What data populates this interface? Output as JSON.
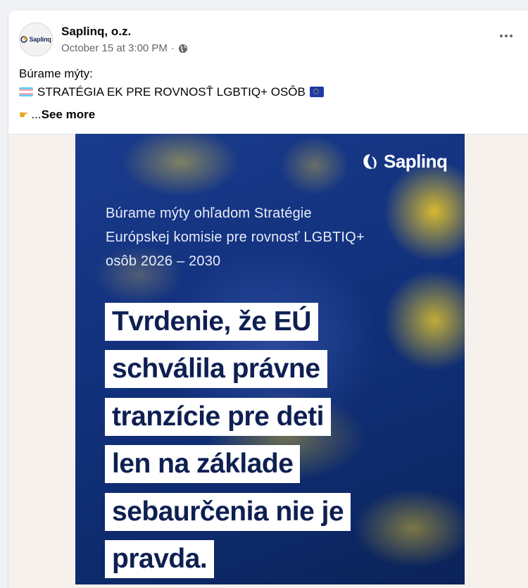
{
  "post": {
    "author": "Saplinq, o.z.",
    "avatar_label": "Saplinq",
    "timestamp": "October 15 at 3:00 PM",
    "separator": "·",
    "privacy_icon": "globe-icon",
    "more_icon": "more-horizontal-icon",
    "text_line1": "Búrame mýty:",
    "text_line2": "STRATÉGIA EK PRE ROVNOSŤ LGBTIQ+ OSÔB",
    "flag_left": "transgender-flag-emoji",
    "flag_right": "eu-flag-emoji",
    "pointing_icon": "pointing-hand-emoji",
    "ellipsis": "...",
    "see_more": "See more"
  },
  "poster": {
    "logo_text": "Saplinq",
    "subtitle_lines": [
      "Búrame mýty ohľadom Stratégie",
      "Európskej komisie pre rovnosť LGBTIQ+",
      "osôb 2026 – 2030"
    ],
    "headline_lines": [
      "Tvrdenie, že EÚ",
      "schválila právne",
      "tranzície pre deti",
      "len na základe",
      "sebaurčenia nie je",
      "pravda."
    ]
  },
  "colors": {
    "poster_blue": "#12327e",
    "star_yellow": "#e6c12a",
    "headline_text": "#0e1f52"
  }
}
